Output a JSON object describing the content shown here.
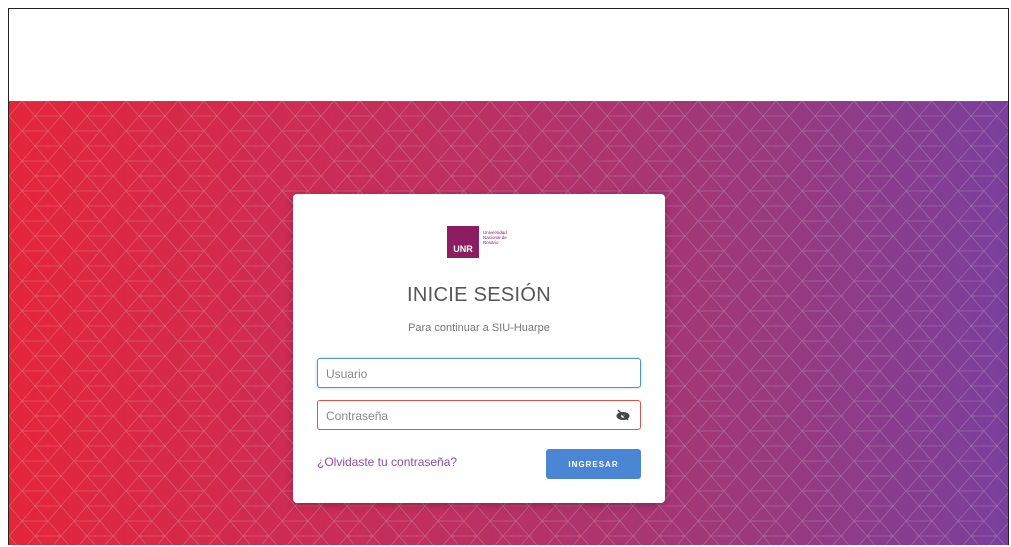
{
  "brand": {
    "logo_short": "UNR",
    "logo_long": "Universidad Nacional de Rosario",
    "color": "#8c1d63"
  },
  "login": {
    "title": "INICIE SESIÓN",
    "subtitle": "Para continuar a SIU-Huarpe",
    "username_placeholder": "Usuario",
    "username_value": "",
    "password_placeholder": "Contraseña",
    "password_value": "",
    "forgot_label": "¿Olvidaste tu contraseña?",
    "submit_label": "INGRESAR",
    "toggle_icon": "eye-icon"
  },
  "colors": {
    "gradient_start": "#e3263a",
    "gradient_end": "#7a3f9c",
    "primary_button": "#4a86d4",
    "link": "#8a4fa0",
    "error_border": "#d9534f",
    "focus_border": "#5b8fc7"
  }
}
